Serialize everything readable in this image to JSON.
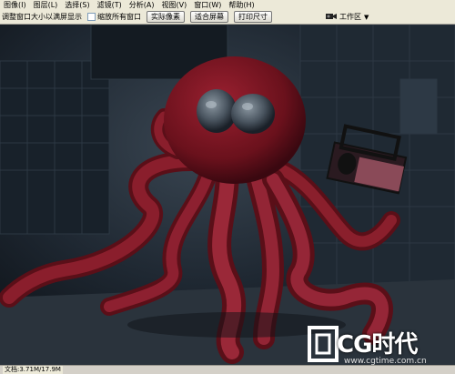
{
  "menu": [
    "图像(I)",
    "图层(L)",
    "选择(S)",
    "滤镜(T)",
    "分析(A)",
    "视图(V)",
    "窗口(W)",
    "帮助(H)"
  ],
  "options": {
    "resize_label": "调整窗口大小以满屏显示",
    "zoom_all_label": "缩放所有窗口",
    "actual_pixels": "实际像素",
    "fit_screen": "适合屏幕",
    "print_size": "打印尺寸",
    "workspace": "工作区",
    "camera_icon": "camera-icon"
  },
  "status": {
    "doc_size": "文档:3.71M/17.9M"
  },
  "watermark": {
    "logo_text": "CG时代",
    "url": "www.cgtime.com.cn"
  },
  "colors": {
    "octopus": "#7a1420",
    "background": "#1b232c"
  }
}
